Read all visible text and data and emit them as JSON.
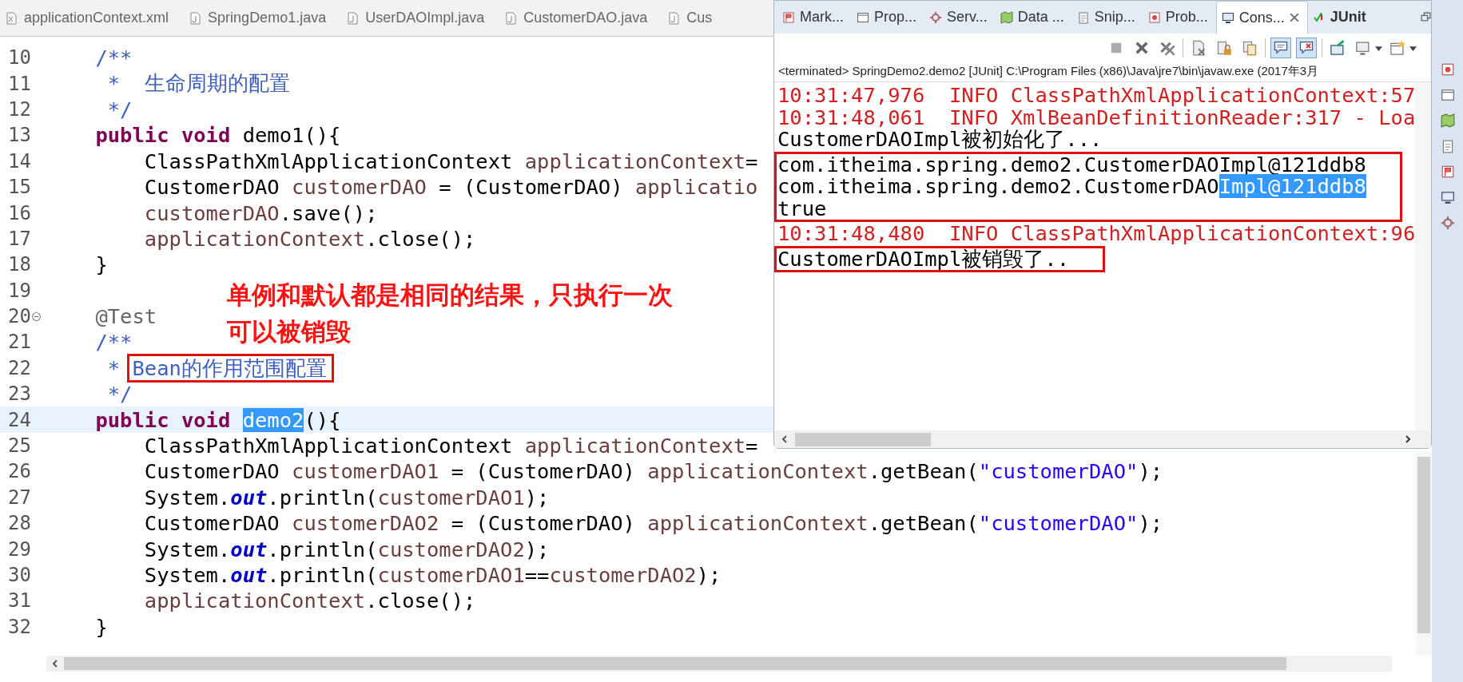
{
  "editor": {
    "tabs": [
      {
        "label": "applicationContext.xml",
        "kind": "xml",
        "selected": false
      },
      {
        "label": "SpringDemo1.java",
        "kind": "java",
        "selected": false
      },
      {
        "label": "UserDAOImpl.java",
        "kind": "java",
        "selected": false
      },
      {
        "label": "CustomerDAO.java",
        "kind": "java",
        "selected": false
      },
      {
        "label": "Cus",
        "kind": "java",
        "selected": false
      }
    ],
    "lines": [
      {
        "number": "10",
        "current": false,
        "fold_marker": false,
        "segments": [
          {
            "text": "    /**",
            "kind": "comment"
          }
        ]
      },
      {
        "number": "11",
        "current": false,
        "fold_marker": false,
        "segments": [
          {
            "text": "     *  生命周期的配置",
            "kind": "comment"
          }
        ]
      },
      {
        "number": "12",
        "current": false,
        "fold_marker": false,
        "segments": [
          {
            "text": "     */",
            "kind": "comment"
          }
        ]
      },
      {
        "number": "13",
        "current": false,
        "fold_marker": false,
        "segments": [
          {
            "text": "    public",
            "kind": "keyword"
          },
          {
            "text": " void",
            "kind": "keyword"
          },
          {
            "text": " demo1(){",
            "kind": "plain"
          }
        ]
      },
      {
        "number": "14",
        "current": false,
        "fold_marker": false,
        "segments": [
          {
            "text": "        ClassPathXmlApplicationContext ",
            "kind": "plain"
          },
          {
            "text": "applicationContext",
            "kind": "var"
          },
          {
            "text": "=",
            "kind": "plain"
          }
        ]
      },
      {
        "number": "15",
        "current": false,
        "fold_marker": false,
        "segments": [
          {
            "text": "        CustomerDAO ",
            "kind": "plain"
          },
          {
            "text": "customerDAO",
            "kind": "var"
          },
          {
            "text": " = (CustomerDAO) ",
            "kind": "plain"
          },
          {
            "text": "applicatio",
            "kind": "var"
          }
        ]
      },
      {
        "number": "16",
        "current": false,
        "fold_marker": false,
        "segments": [
          {
            "text": "        customerDAO",
            "kind": "var"
          },
          {
            "text": ".save();",
            "kind": "plain"
          }
        ]
      },
      {
        "number": "17",
        "current": false,
        "fold_marker": false,
        "segments": [
          {
            "text": "        applicationContext",
            "kind": "var"
          },
          {
            "text": ".close();",
            "kind": "plain"
          }
        ]
      },
      {
        "number": "18",
        "current": false,
        "fold_marker": false,
        "segments": [
          {
            "text": "    }",
            "kind": "plain"
          }
        ]
      },
      {
        "number": "19",
        "current": false,
        "fold_marker": false
      },
      {
        "number": "20",
        "current": false,
        "fold_marker": true,
        "segments": [
          {
            "text": "    @Test",
            "kind": "annotation"
          }
        ]
      },
      {
        "number": "21",
        "current": false,
        "fold_marker": false,
        "segments": [
          {
            "text": "    /**",
            "kind": "comment"
          }
        ]
      },
      {
        "number": "22",
        "current": false,
        "fold_marker": false,
        "segments": [
          {
            "text": "     * ",
            "kind": "comment",
            "boxed": false
          },
          {
            "text": "Bean的作用范围配置",
            "kind": "comment",
            "boxed": true
          }
        ]
      },
      {
        "number": "23",
        "current": false,
        "fold_marker": false,
        "segments": [
          {
            "text": "     */",
            "kind": "comment"
          }
        ]
      },
      {
        "number": "24",
        "current": true,
        "fold_marker": false,
        "segments": [
          {
            "text": "    public",
            "kind": "keyword"
          },
          {
            "text": " void ",
            "kind": "keyword"
          },
          {
            "text": "demo2",
            "kind": "selected"
          },
          {
            "text": "(){",
            "kind": "plain"
          }
        ]
      },
      {
        "number": "25",
        "current": false,
        "fold_marker": false,
        "segments": [
          {
            "text": "        ClassPathXmlApplicationContext ",
            "kind": "plain"
          },
          {
            "text": "applicationContext",
            "kind": "var"
          },
          {
            "text": "=",
            "kind": "plain"
          }
        ]
      },
      {
        "number": "26",
        "current": false,
        "fold_marker": false,
        "segments": [
          {
            "text": "        CustomerDAO ",
            "kind": "plain"
          },
          {
            "text": "customerDAO1",
            "kind": "var"
          },
          {
            "text": " = (CustomerDAO) ",
            "kind": "plain"
          },
          {
            "text": "applicationContext",
            "kind": "var"
          },
          {
            "text": ".getBean(",
            "kind": "plain"
          },
          {
            "text": "\"customerDAO\"",
            "kind": "string"
          },
          {
            "text": ");",
            "kind": "plain"
          }
        ]
      },
      {
        "number": "27",
        "current": false,
        "fold_marker": false,
        "segments": [
          {
            "text": "        System.",
            "kind": "plain"
          },
          {
            "text": "out",
            "kind": "field"
          },
          {
            "text": ".println(",
            "kind": "plain"
          },
          {
            "text": "customerDAO1",
            "kind": "var"
          },
          {
            "text": ");",
            "kind": "plain"
          }
        ]
      },
      {
        "number": "28",
        "current": false,
        "fold_marker": false,
        "segments": [
          {
            "text": "        CustomerDAO ",
            "kind": "plain"
          },
          {
            "text": "customerDAO2",
            "kind": "var"
          },
          {
            "text": " = (CustomerDAO) ",
            "kind": "plain"
          },
          {
            "text": "applicationContext",
            "kind": "var"
          },
          {
            "text": ".getBean(",
            "kind": "plain"
          },
          {
            "text": "\"customerDAO\"",
            "kind": "string"
          },
          {
            "text": ");",
            "kind": "plain"
          }
        ]
      },
      {
        "number": "29",
        "current": false,
        "fold_marker": false,
        "segments": [
          {
            "text": "        System.",
            "kind": "plain"
          },
          {
            "text": "out",
            "kind": "field"
          },
          {
            "text": ".println(",
            "kind": "plain"
          },
          {
            "text": "customerDAO2",
            "kind": "var"
          },
          {
            "text": ");",
            "kind": "plain"
          }
        ]
      },
      {
        "number": "30",
        "current": false,
        "fold_marker": false,
        "segments": [
          {
            "text": "        System.",
            "kind": "plain"
          },
          {
            "text": "out",
            "kind": "field"
          },
          {
            "text": ".println(",
            "kind": "plain"
          },
          {
            "text": "customerDAO1",
            "kind": "var"
          },
          {
            "text": "==",
            "kind": "plain"
          },
          {
            "text": "customerDAO2",
            "kind": "var"
          },
          {
            "text": ");",
            "kind": "plain"
          }
        ]
      },
      {
        "number": "31",
        "current": false,
        "fold_marker": false,
        "segments": [
          {
            "text": "        applicationContext",
            "kind": "var"
          },
          {
            "text": ".close();",
            "kind": "plain"
          }
        ]
      },
      {
        "number": "32",
        "current": false,
        "fold_marker": false,
        "segments": [
          {
            "text": "    }",
            "kind": "plain"
          }
        ]
      }
    ]
  },
  "annotation": {
    "lines": [
      "单例和默认都是相同的结果，只执行一次",
      "可以被销毁"
    ]
  },
  "console": {
    "tabs": [
      {
        "label": "Mark...",
        "kind": "markers",
        "selected": false
      },
      {
        "label": "Prop...",
        "kind": "properties",
        "selected": false
      },
      {
        "label": "Serv...",
        "kind": "servers",
        "selected": false
      },
      {
        "label": "Data ...",
        "kind": "data",
        "selected": false
      },
      {
        "label": "Snip...",
        "kind": "snippets",
        "selected": false
      },
      {
        "label": "Prob...",
        "kind": "problems",
        "selected": false
      },
      {
        "label": "Cons...",
        "kind": "console",
        "selected": true
      },
      {
        "label": "JUnit",
        "kind": "junit",
        "selected": false
      }
    ],
    "toolbar": [
      {
        "kind": "stop",
        "selected": false
      },
      {
        "kind": "remove",
        "selected": false
      },
      {
        "kind": "remove_all",
        "selected": false
      },
      {
        "kind": "clear",
        "selected": false
      },
      {
        "kind": "lock",
        "selected": false
      },
      {
        "kind": "copy",
        "selected": false
      },
      {
        "kind": "show_out",
        "selected": true
      },
      {
        "kind": "show_err",
        "selected": true
      },
      {
        "kind": "pin",
        "selected": false
      },
      {
        "kind": "display",
        "selected": false
      },
      {
        "kind": "new",
        "selected": false
      }
    ],
    "header": "<terminated> SpringDemo2.demo2 [JUnit] C:\\Program Files (x86)\\Java\\jre7\\bin\\javaw.exe (2017年3月",
    "blocks": [
      {
        "boxed": false,
        "lines": [
          {
            "kind": "log",
            "segments": [
              {
                "text": "10:31:47,976  INFO ClassPathXmlApplicationContext:57",
                "kind": "plain"
              }
            ]
          },
          {
            "kind": "log",
            "segments": [
              {
                "text": "10:31:48,061  INFO XmlBeanDefinitionReader:317 - Loa",
                "kind": "plain"
              }
            ]
          },
          {
            "kind": "output",
            "segments": [
              {
                "text": "CustomerDAOImpl被初始化了...",
                "kind": "plain"
              }
            ]
          }
        ]
      },
      {
        "boxed": true,
        "lines": [
          {
            "kind": "output",
            "segments": [
              {
                "text": "com.itheima.spring.demo2.CustomerDAOImpl@121ddb8",
                "kind": "plain"
              }
            ]
          },
          {
            "kind": "output",
            "segments": [
              {
                "text": "com.itheima.spring.demo2.CustomerDAO",
                "kind": "plain"
              },
              {
                "text": "Impl@121ddb8",
                "kind": "selected"
              }
            ]
          },
          {
            "kind": "output",
            "segments": [
              {
                "text": "true",
                "kind": "plain"
              }
            ]
          }
        ]
      },
      {
        "boxed": false,
        "lines": [
          {
            "kind": "log",
            "segments": [
              {
                "text": "10:31:48,480  INFO ClassPathXmlApplicationContext:96",
                "kind": "plain"
              }
            ]
          }
        ]
      },
      {
        "boxed": true,
        "lines": [
          {
            "kind": "output",
            "segments": [
              {
                "text": "CustomerDAOImpl被销毁了..",
                "kind": "plain"
              }
            ]
          }
        ]
      }
    ]
  }
}
